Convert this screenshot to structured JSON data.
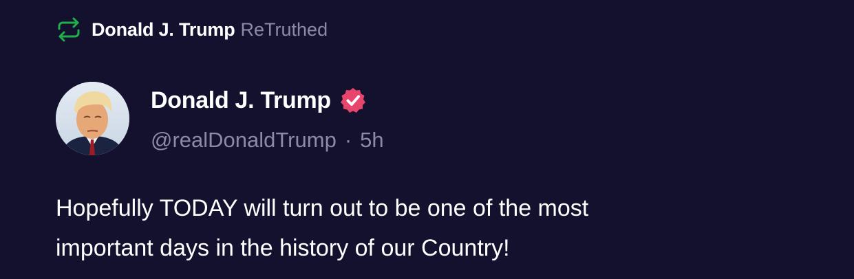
{
  "retruth": {
    "name": "Donald J. Trump",
    "label": "ReTruthed",
    "icon": "retruth-icon",
    "icon_color": "#20b04a"
  },
  "author": {
    "name": "Donald J. Trump",
    "verified_icon": "verified-badge-icon",
    "verified_color": "#e8456d",
    "handle": "@realDonaldTrump",
    "separator": "·",
    "time": "5h"
  },
  "post": {
    "text_line1": "Hopefully TODAY will turn out to be one of the most",
    "text_line2": "important days in the history of our Country!"
  },
  "colors": {
    "background": "#14112f",
    "primary_text": "#ffffff",
    "secondary_text": "#8e8aa6"
  }
}
